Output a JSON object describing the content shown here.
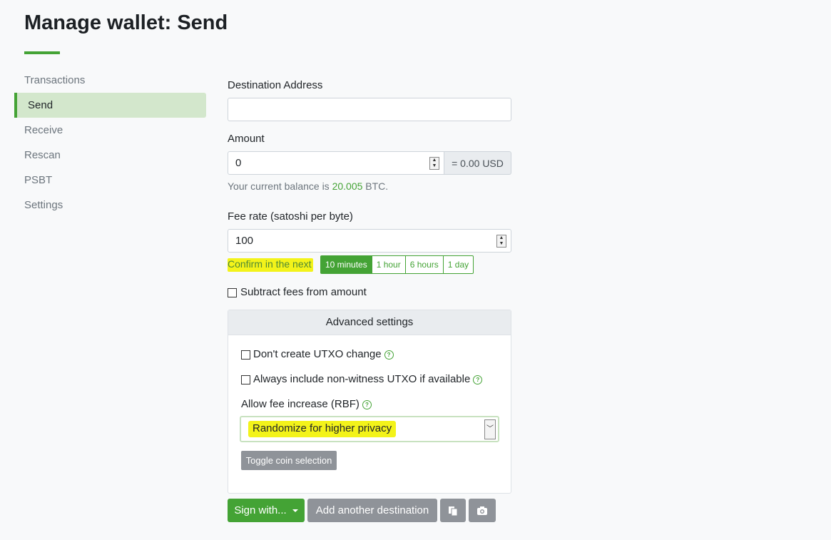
{
  "page": {
    "title": "Manage wallet: Send"
  },
  "nav": {
    "items": [
      {
        "label": "Transactions"
      },
      {
        "label": "Send"
      },
      {
        "label": "Receive"
      },
      {
        "label": "Rescan"
      },
      {
        "label": "PSBT"
      },
      {
        "label": "Settings"
      }
    ],
    "active": "Send"
  },
  "form": {
    "destination": {
      "label": "Destination Address",
      "value": ""
    },
    "amount": {
      "label": "Amount",
      "value": "0",
      "fiat": "= 0.00 USD"
    },
    "balance": {
      "prefix": "Your current balance is",
      "value": "20.005",
      "unit": "BTC."
    },
    "fee": {
      "label": "Fee rate (satoshi per byte)",
      "value": "100"
    },
    "confirm": {
      "label": "Confirm in the next",
      "options": [
        "10 minutes",
        "1 hour",
        "6 hours",
        "1 day"
      ],
      "selected": "10 minutes"
    },
    "subtract_fees": {
      "label": "Subtract fees from amount",
      "checked": false
    }
  },
  "advanced": {
    "header": "Advanced settings",
    "no_change": {
      "label": "Don't create UTXO change",
      "checked": false
    },
    "non_witness": {
      "label": "Always include non-witness UTXO if available",
      "checked": false
    },
    "rbf": {
      "label": "Allow fee increase (RBF)",
      "selected": "Randomize for higher privacy"
    },
    "toggle_coin_selection": "Toggle coin selection",
    "help_glyph": "?"
  },
  "actions": {
    "sign_with": "Sign with...",
    "add_destination": "Add another destination"
  },
  "icons": {
    "help": "help-circle-icon",
    "paste": "paste-icon",
    "camera": "camera-icon",
    "caret": "caret-down-icon"
  },
  "colors": {
    "accent": "#44a335",
    "highlight": "#f3f31a",
    "nav_active_bg": "#d3e7cc"
  }
}
